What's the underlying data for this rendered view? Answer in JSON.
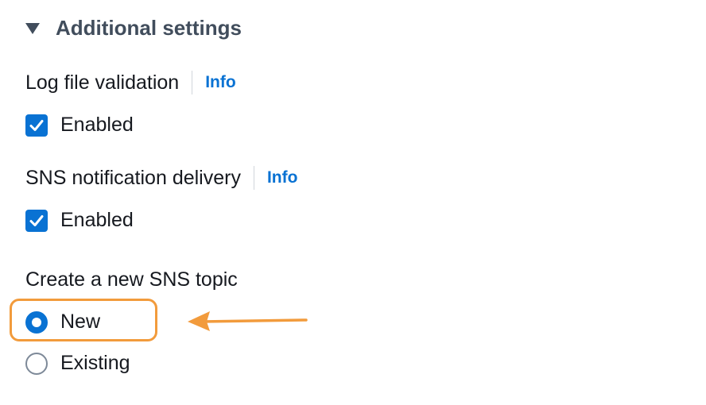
{
  "section": {
    "title": "Additional settings",
    "caret_icon": "caret-down-icon"
  },
  "log_file_validation": {
    "label": "Log file validation",
    "info": "Info",
    "checkbox_label": "Enabled",
    "checked": true
  },
  "sns_notification": {
    "label": "SNS notification delivery",
    "info": "Info",
    "checkbox_label": "Enabled",
    "checked": true
  },
  "sns_topic": {
    "label": "Create a new SNS topic",
    "options": [
      {
        "label": "New",
        "selected": true
      },
      {
        "label": "Existing",
        "selected": false
      }
    ]
  },
  "annotation": {
    "highlight_color": "#f29b3c",
    "arrow_icon": "arrow-left-icon"
  },
  "colors": {
    "accent": "#0972d3",
    "heading": "#414d5c",
    "text": "#16191f",
    "annotation": "#f29b3c"
  }
}
